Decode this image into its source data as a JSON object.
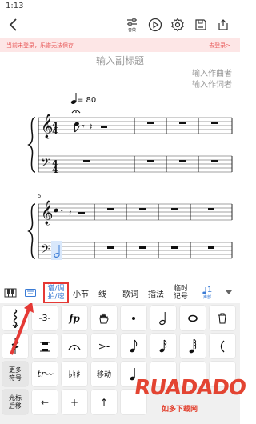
{
  "status": {
    "time": "1:13"
  },
  "toolbar": {
    "back_icon": "chevron-left-icon",
    "mixer_label": "音效",
    "mixer_icon": "mixer-sliders-icon",
    "play_icon": "play-circle-icon",
    "settings_icon": "gear-icon",
    "save_icon": "save-icon",
    "export_icon": "export-icon"
  },
  "banner": {
    "message": "当前未登录，乐谱无法保存",
    "login": "去登录>"
  },
  "score": {
    "subtitle": "输入副标题",
    "composer": "输入作曲者",
    "lyricist": "输入作词者",
    "tempo": "= 80",
    "measure_number": "5"
  },
  "tabs": [
    {
      "label": "",
      "icon": "piano-keyboard-icon"
    },
    {
      "label": "",
      "icon": "keyboard-icon"
    },
    {
      "label_line1": "谱/调",
      "label_line2": "拍/速",
      "active": true
    },
    {
      "label": "小节"
    },
    {
      "label": "线"
    },
    {
      "label": "歌词"
    },
    {
      "label": "指法"
    },
    {
      "label_line1": "临时",
      "label_line2": "记号"
    },
    {
      "label": "1",
      "sub": "声部",
      "icon": "voice-note-icon"
    },
    {
      "label": "",
      "icon": "dropdown-arrow-icon"
    }
  ],
  "keypad": {
    "row1": [
      "",
      "-3-",
      "fp",
      "",
      "",
      "",
      "",
      ""
    ],
    "row2": [
      "",
      "",
      "",
      ">-",
      "",
      "",
      "",
      ""
    ],
    "row3": [
      "更多符号",
      "tr",
      "",
      "移动",
      "",
      "",
      "",
      ""
    ],
    "row4": [
      "光标后移",
      "←",
      "+",
      "↑",
      "",
      "",
      "",
      ""
    ]
  },
  "watermark": {
    "big": "RUADADO",
    "small": "如多下载网"
  },
  "colors": {
    "banner_bg": "#fde6e6",
    "banner_text": "#e85a5a",
    "accent": "#3a7bd5",
    "highlight": "#e53935"
  }
}
